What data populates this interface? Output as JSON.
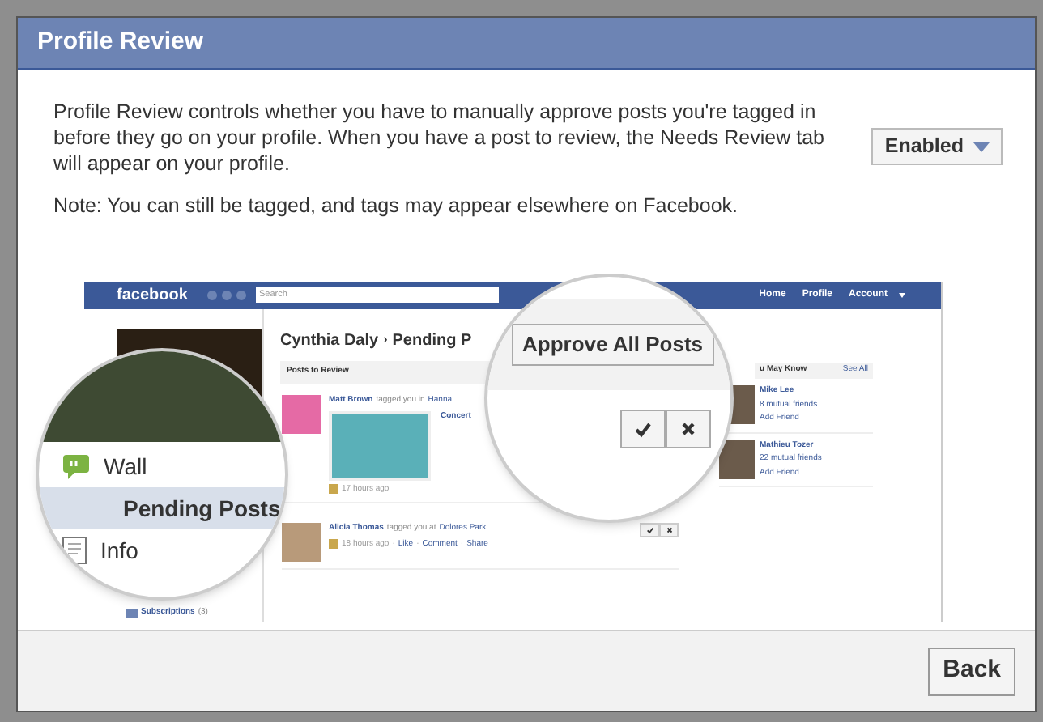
{
  "dialog": {
    "title": "Profile Review"
  },
  "description": "Profile Review controls whether you have to manually approve posts you're tagged in before they go on your profile. When you have a post to review, the Needs Review tab will appear on your profile.",
  "setting": {
    "value": "Enabled"
  },
  "note": "Note: You can still be tagged, and tags may appear elsewhere on Facebook.",
  "illustration": {
    "navbar": {
      "logo": "facebook",
      "search_placeholder": "Search",
      "links": [
        "Home",
        "Profile",
        "Account"
      ]
    },
    "sidebar": {
      "items": [
        {
          "label": "Subscriptions",
          "count": "(3)"
        }
      ]
    },
    "heading": {
      "name": "Cynthia Daly",
      "separator": "›",
      "page": "Pending P"
    },
    "section_title": "Posts to Review",
    "posts": [
      {
        "author": "Matt Brown",
        "action": "tagged you in",
        "place": "Hanna",
        "caption": "Concert",
        "time": "17 hours ago"
      },
      {
        "author": "Alicia Thomas",
        "action": "tagged you at",
        "place": "Dolores Park.",
        "time": "18 hours ago",
        "separator": "·",
        "actions": [
          "Like",
          "Comment",
          "Share"
        ]
      }
    ],
    "people": {
      "title": "u May Know",
      "see_all": "See All",
      "items": [
        {
          "name": "Mike Lee",
          "mutual": "8 mutual friends",
          "add": "Add Friend"
        },
        {
          "name": "Mathieu Tozer",
          "mutual": "22 mutual friends",
          "add": "Add Friend"
        }
      ]
    },
    "magnifier_left": {
      "items": [
        {
          "label": "Wall",
          "kind": "wall",
          "selected": false
        },
        {
          "label": "Pending Posts",
          "kind": "sub",
          "selected": true
        },
        {
          "label": "Info",
          "kind": "info",
          "selected": false
        }
      ]
    },
    "magnifier_right": {
      "button": "Approve All Posts"
    }
  },
  "buttons": [
    "Back"
  ]
}
